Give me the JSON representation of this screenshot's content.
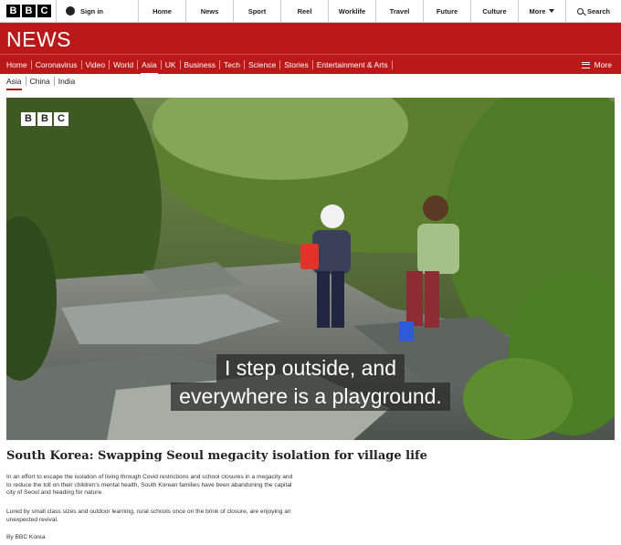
{
  "topbar": {
    "logo_letters": [
      "B",
      "B",
      "C"
    ],
    "signin_label": "Sign in",
    "nav": [
      "Home",
      "News",
      "Sport",
      "Reel",
      "Worklife",
      "Travel",
      "Future",
      "Culture"
    ],
    "more_label": "More",
    "search_label": "Search"
  },
  "section": {
    "title": "NEWS",
    "brand_color": "#bb1919",
    "subnav": [
      "Home",
      "Coronavirus",
      "Video",
      "World",
      "Asia",
      "UK",
      "Business",
      "Tech",
      "Science",
      "Stories",
      "Entertainment & Arts"
    ],
    "active_subnav": "Asia",
    "more_label": "More"
  },
  "secondary_nav": {
    "items": [
      "Asia",
      "China",
      "India"
    ],
    "active": "Asia"
  },
  "video": {
    "watermark_letters": [
      "B",
      "B",
      "C"
    ],
    "caption_lines": [
      "I step outside, and",
      "everywhere is a playground."
    ]
  },
  "article": {
    "headline": "South Korea: Swapping Seoul megacity isolation for village life",
    "paragraph1": "In an effort to escape the isolation of living through Covid restrictions and school closures in a megacity and to reduce the toll on their children's mental health, South Korean families have been abandoning the capital city of Seoul and heading for nature.",
    "paragraph2": "Lured by small class sizes and outdoor learning, rural schools once on the brink of closure, are enjoying an unexpected revival.",
    "byline": "By BBC Korea"
  }
}
